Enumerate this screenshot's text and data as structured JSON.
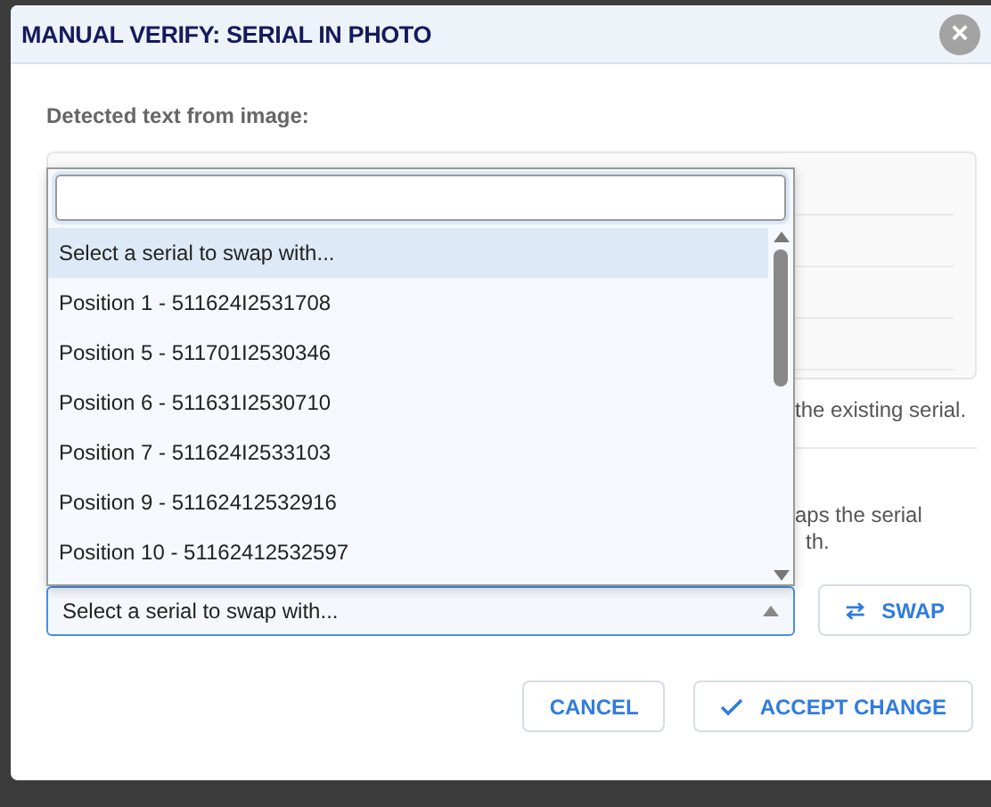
{
  "dialog": {
    "title": "MANUAL VERIFY: SERIAL IN PHOTO",
    "close": "×"
  },
  "detected_label": "Detected text from image:",
  "note_1": "the existing serial.",
  "note_2": [
    "aps the serial",
    "th."
  ],
  "serial_select": {
    "value": "Select a serial to swap with...",
    "open": true,
    "options": [
      {
        "label": "Select a serial to swap with...",
        "selected": true
      },
      {
        "label": "Position 1 - 511624I2531708",
        "selected": false
      },
      {
        "label": "Position 5 - 511701I2530346",
        "selected": false
      },
      {
        "label": "Position 6 - 511631I2530710",
        "selected": false
      },
      {
        "label": "Position 7 - 511624I2533103",
        "selected": false
      },
      {
        "label": "Position 9 - 51162412532916",
        "selected": false
      },
      {
        "label": "Position 10 - 51162412532597",
        "selected": false
      }
    ]
  },
  "swap_button": "SWAP",
  "buttons": [
    {
      "label": "CANCEL",
      "kind": "plain"
    },
    {
      "label": "ACCEPT CHANGE",
      "kind": "check"
    }
  ]
}
